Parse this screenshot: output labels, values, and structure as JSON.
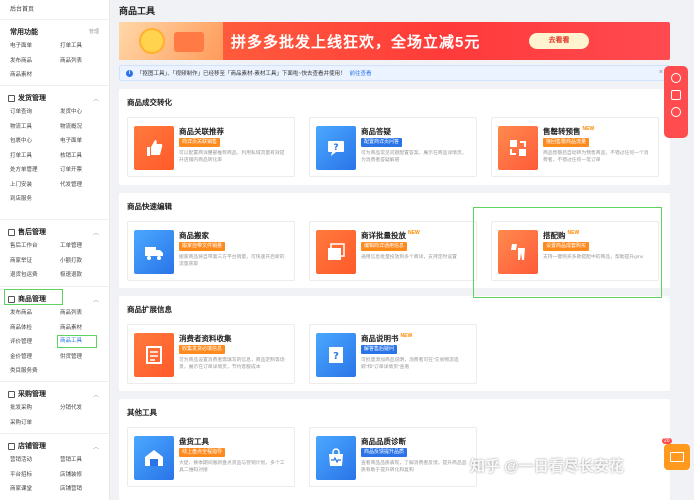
{
  "sidebar": {
    "top": "后台首页",
    "groups": [
      {
        "title": "常用功能",
        "action": "管理",
        "items": [
          "电子面单",
          "打单工具",
          "发布商品",
          "商品列表",
          "商品素材"
        ]
      },
      {
        "title": "发货管理",
        "items": [
          "订单查询",
          "发货中心",
          "物流工具",
          "物流概况",
          "包裹中心",
          "电子面单",
          "打单工具",
          "核销工具",
          "处方单管理",
          "订单开票",
          "上门安装",
          "代发管理",
          "到店服务"
        ]
      },
      {
        "title": "售后管理",
        "items": [
          "售后工作台",
          "工单管理",
          "商家举证",
          "小额打款",
          "退货包运费",
          "极速退款"
        ]
      },
      {
        "title": "商品管理",
        "items": [
          "发布商品",
          "商品列表",
          "商品体检",
          "商品素材",
          "评价管理",
          "商品工具",
          "金价管理",
          "供货管理",
          "类目服务费"
        ]
      },
      {
        "title": "采购管理",
        "items": [
          "批发采购",
          "分销代发",
          "采购订单"
        ]
      },
      {
        "title": "店铺管理",
        "items": [
          "营销活动",
          "营销工具",
          "平台招标",
          "店铺装修",
          "商家课堂",
          "店铺营销"
        ]
      }
    ]
  },
  "main": {
    "title": "商品工具",
    "banner": {
      "text": "拼多多批发上线狂欢，全场立减5元",
      "button": "去看看"
    },
    "notice": {
      "text": "「抠图工具」、「视频制作」已经移至「商品素材-素材工具」下面啦~快去查看并使用！",
      "link": "前往查看"
    },
    "sections": [
      {
        "title": "商品成交转化",
        "cards": [
          {
            "title": "商品关联推荐",
            "new": "",
            "tag": "商详页关联销售",
            "desc": "可以配置商详腰部推荐商品，利用私域流量有效提升店铺内商品转化率"
          },
          {
            "title": "商品答疑",
            "new": "",
            "tag": "配置商详页问答",
            "desc": "可为商品常见问题配置答案，展示在商品详情页，为消费者答疑解惑"
          },
          {
            "title": "售罄转预售",
            "new": "NEW",
            "tag": "挽回售罄商品流量",
            "desc": "商品售罄后自动转为预售商品，不错过任何一个消费者，不错过任何一笔订单"
          }
        ]
      },
      {
        "title": "商品快速编辑",
        "cards": [
          {
            "title": "商品搬家",
            "new": "",
            "tag": "搬家自带文件销量",
            "desc": "搬家商品将自带第三方平台销量，可快速开启新的流量获取"
          },
          {
            "title": "商详批量投放",
            "new": "NEW",
            "tag": "编辑商详通用信息",
            "desc": "通用信息批量投放到多个商详，支持定时设置"
          },
          {
            "title": "搭配购",
            "new": "NEW",
            "tag": "设置商品成套购买",
            "desc": "支持一键购买多款搭配中的商品，帮助提升gmv"
          }
        ]
      },
      {
        "title": "商品扩展信息",
        "cards": [
          {
            "title": "消费者资料收集",
            "new": "",
            "tag": "收集发货必填信息",
            "desc": "可为商品设置消费者需填写的信息，商品定制等场景，展示在订单详情页，节约客服成本"
          },
          {
            "title": "商品说明书",
            "new": "NEW",
            "tag": "解答售后疑问",
            "desc": "可批量添加商品说明，消费者可在\"交易物流追踪\"和\"订单详情页\"查看"
          }
        ]
      },
      {
        "title": "其他工具",
        "cards": [
          {
            "title": "盘货工具",
            "new": "",
            "tag": "线上盘点全程指导",
            "desc": "大促、换季期间搬新盘点货品与营销计划，多个工具二维码对接"
          },
          {
            "title": "商品品质诊断",
            "new": "",
            "tag": "商品反馈提升品质",
            "desc": "查看商品品质表现，了解消费者反馈，提升商品品质有助于提升转化和复购"
          }
        ]
      }
    ]
  },
  "mail_badge": "20",
  "watermark": "知乎 @一日看尽长安花"
}
